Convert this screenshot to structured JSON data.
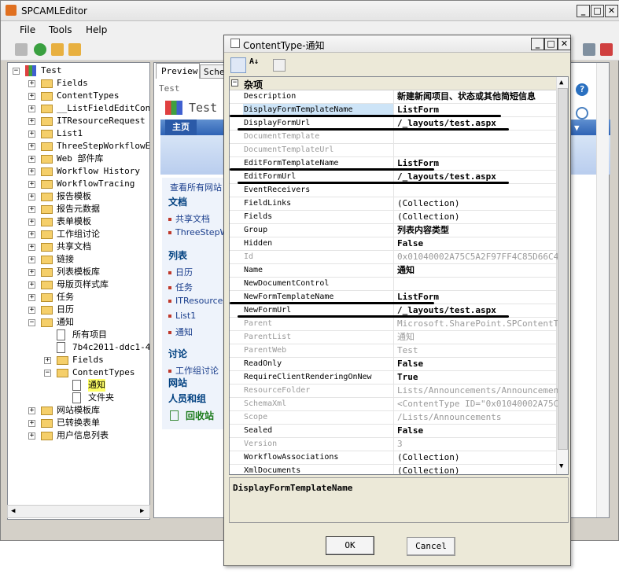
{
  "app": {
    "title": "SPCAMLEditor"
  },
  "menu": [
    "File",
    "Tools",
    "Help"
  ],
  "tree": {
    "root": "Test",
    "items": [
      "Fields",
      "ContentTypes",
      "__ListFieldEditContr",
      "ITResourceRequest",
      "List1",
      "ThreeStepWorkflowExa",
      "Web 部件库",
      "Workflow History",
      "WorkflowTracing",
      "报告模板",
      "报告元数据",
      "表单模板",
      "工作组讨论",
      "共享文档",
      "链接",
      "列表模板库",
      "母版页样式库",
      "任务",
      "日历",
      "通知"
    ],
    "notice_children": [
      "所有项目",
      "7b4c2011-ddc1-44:",
      "Fields",
      "ContentTypes"
    ],
    "ct_children": [
      "通知",
      "文件夹"
    ],
    "after": [
      "网站模板库",
      "已转换表单",
      "用户信息列表"
    ]
  },
  "preview": {
    "tabs": [
      "Preview",
      "Schem"
    ],
    "crumb": "Test",
    "site_title": "Test",
    "home_tab": "主页",
    "view_all": "查看所有网站",
    "sections": [
      {
        "head": "文档",
        "items": [
          "共享文档",
          "ThreeStepW"
        ]
      },
      {
        "head": "列表",
        "items": [
          "日历",
          "任务",
          "ITResource",
          "List1",
          "通知"
        ]
      },
      {
        "head": "讨论",
        "items": [
          "工作组讨论"
        ]
      }
    ],
    "sites": "网站",
    "people": "人员和组",
    "recycle": "回收站"
  },
  "dialog": {
    "title": "ContentType-通知",
    "category": "杂项",
    "rows": [
      {
        "n": "Description",
        "v": "新建新闻项目、状态或其他简短信息"
      },
      {
        "n": "DisplayFormTemplateName",
        "v": "ListForm"
      },
      {
        "n": "DisplayFormUrl",
        "v": "/_layouts/test.aspx"
      },
      {
        "n": "DocumentTemplate",
        "v": ""
      },
      {
        "n": "DocumentTemplateUrl",
        "v": ""
      },
      {
        "n": "EditFormTemplateName",
        "v": "ListForm"
      },
      {
        "n": "EditFormUrl",
        "v": "/_layouts/test.aspx"
      },
      {
        "n": "EventReceivers",
        "v": ""
      },
      {
        "n": "FieldLinks",
        "v": "(Collection)"
      },
      {
        "n": "Fields",
        "v": "(Collection)"
      },
      {
        "n": "Group",
        "v": "列表内容类型"
      },
      {
        "n": "Hidden",
        "v": "False"
      },
      {
        "n": "Id",
        "v": "0x01040002A75C5A2F97FF4C85D66C45CD"
      },
      {
        "n": "Name",
        "v": "通知"
      },
      {
        "n": "NewDocumentControl",
        "v": ""
      },
      {
        "n": "NewFormTemplateName",
        "v": "ListForm"
      },
      {
        "n": "NewFormUrl",
        "v": "/_layouts/test.aspx"
      },
      {
        "n": "Parent",
        "v": "Microsoft.SharePoint.SPContentType"
      },
      {
        "n": "ParentList",
        "v": "通知"
      },
      {
        "n": "ParentWeb",
        "v": "Test"
      },
      {
        "n": "ReadOnly",
        "v": "False"
      },
      {
        "n": "RequireClientRenderingOnNew",
        "v": "True"
      },
      {
        "n": "ResourceFolder",
        "v": "Lists/Announcements/Announcement"
      },
      {
        "n": "SchemaXml",
        "v": "<ContentType ID=\"0x01040002A75C5A2"
      },
      {
        "n": "Scope",
        "v": "/Lists/Announcements"
      },
      {
        "n": "Sealed",
        "v": "False"
      },
      {
        "n": "Version",
        "v": "3"
      },
      {
        "n": "WorkflowAssociations",
        "v": "(Collection)"
      },
      {
        "n": "XmlDocuments",
        "v": "(Collection)"
      }
    ],
    "description": "DisplayFormTemplateName",
    "ok": "OK",
    "cancel": "Cancel"
  }
}
